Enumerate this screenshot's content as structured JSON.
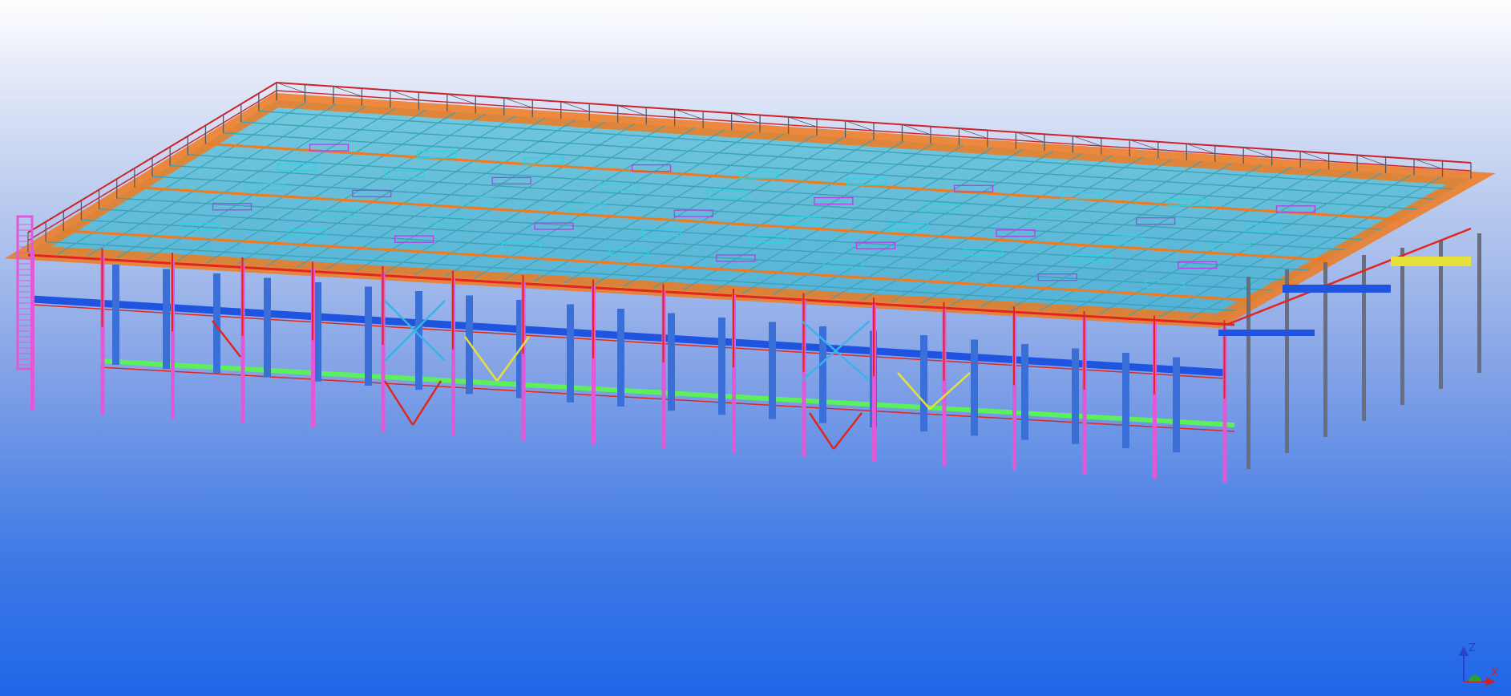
{
  "viewport": {
    "background_top": "#ffffff",
    "background_bottom": "#1f66e8"
  },
  "model": {
    "colors": {
      "roof_cyan": "#1fb3c8",
      "purlin_teal": "#3aa3b8",
      "edge_orange": "#f07a1e",
      "rail_red": "#d0202a",
      "frame_red": "#e0261f",
      "column_magenta": "#e05ad8",
      "column_blue": "#3a6fd8",
      "column_gray": "#6b6e7a",
      "beam_blue": "#1e54e0",
      "beam_green": "#5cf05a",
      "brace_cyan": "#3ab3e8",
      "brace_yellow": "#e8e03a"
    }
  },
  "axis_triad": {
    "z_label": "Z",
    "x_label": "X",
    "z_color": "#2a40c8",
    "x_color": "#d02020",
    "y_color": "#2aa030"
  }
}
